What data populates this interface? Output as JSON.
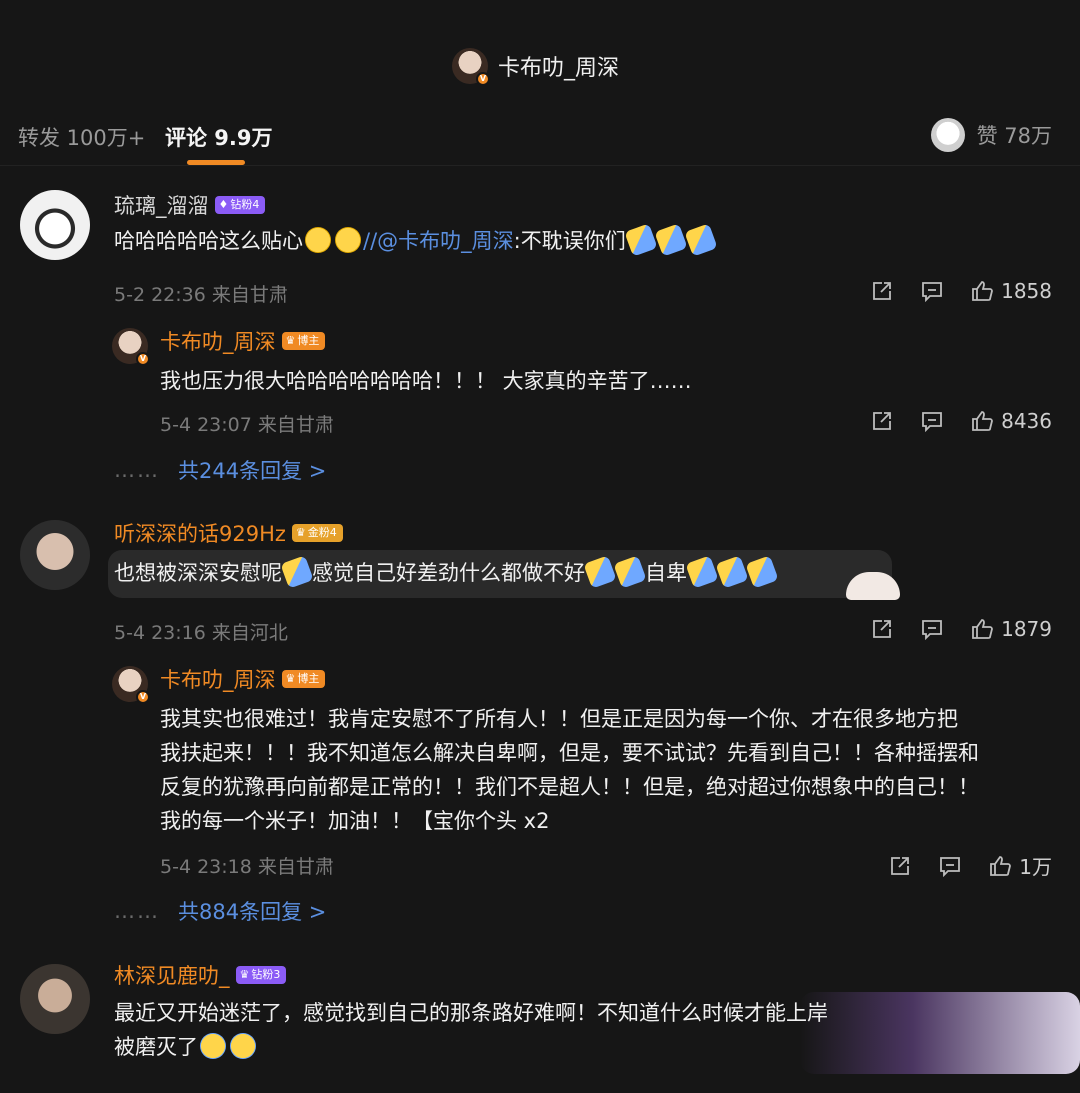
{
  "header": {
    "title": "卡布叻_周深"
  },
  "tabs": {
    "repost": "转发 100万+",
    "comment": "评论 9.9万",
    "likes": "赞 78万"
  },
  "comments": [
    {
      "user": "琉璃_溜溜",
      "badge": "钻粉4",
      "text_prefix": "哈哈哈哈哈这么贴心",
      "mention": "//@卡布叻_周深",
      "text_suffix": ":不耽误你们",
      "meta": "5-2 22:36 来自甘肃",
      "likes": "1858",
      "reply": {
        "user": "卡布叻_周深",
        "badge": "博主",
        "text": "我也压力很大哈哈哈哈哈哈哈！！！ 大家真的辛苦了……",
        "meta": "5-4 23:07 来自甘肃",
        "likes": "8436"
      },
      "more_replies": "共244条回复 >"
    },
    {
      "user": "听深深的话929Hz",
      "badge": "金粉4",
      "text_a": "也想被深深安慰呢",
      "text_b": "感觉自己好差劲什么都做不好",
      "text_c": "自卑",
      "meta": "5-4 23:16 来自河北",
      "likes": "1879",
      "reply": {
        "user": "卡布叻_周深",
        "badge": "博主",
        "lines": [
          "我其实也很难过！我肯定安慰不了所有人！！但是正是因为每一个你、才在很多地方把",
          "我扶起来！！！我不知道怎么解决自卑啊，但是，要不试试？先看到自己！！各种摇摆和",
          "反复的犹豫再向前都是正常的！！我们不是超人！！但是，绝对超过你想象中的自己！！",
          "我的每一个米子！加油！！【宝你个头 x2"
        ],
        "meta": "5-4 23:18 来自甘肃",
        "likes": "1万"
      },
      "more_replies": "共884条回复 >"
    },
    {
      "user": "林深见鹿叻_",
      "badge": "钻粉3",
      "line1": "最近又开始迷茫了，感觉找到自己的那条路好难啊！不知道什么时候才能上岸",
      "line2": "被磨灭了"
    }
  ],
  "colors": {
    "accent": "#f08a24",
    "link": "#5b8fe0",
    "background": "#161616"
  }
}
